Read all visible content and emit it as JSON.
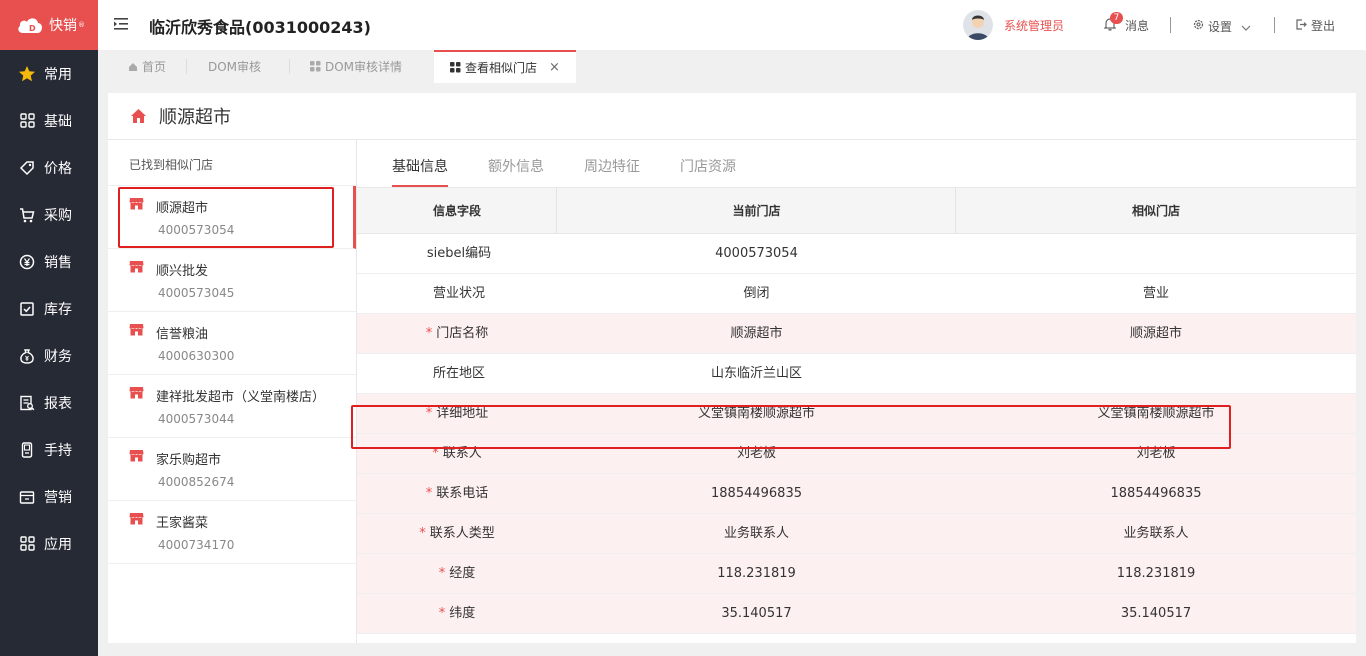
{
  "app": {
    "brand": "快销",
    "brand_mark": "®"
  },
  "sidebar": {
    "items": [
      {
        "label": "常用",
        "icon": "star-icon"
      },
      {
        "label": "基础",
        "icon": "grid-icon"
      },
      {
        "label": "价格",
        "icon": "tag-icon"
      },
      {
        "label": "采购",
        "icon": "cart-icon"
      },
      {
        "label": "销售",
        "icon": "yen-icon"
      },
      {
        "label": "库存",
        "icon": "checkbox-icon"
      },
      {
        "label": "财务",
        "icon": "moneybag-icon"
      },
      {
        "label": "报表",
        "icon": "report-icon"
      },
      {
        "label": "手持",
        "icon": "handheld-icon"
      },
      {
        "label": "营销",
        "icon": "shop-icon"
      },
      {
        "label": "应用",
        "icon": "apps-icon"
      }
    ]
  },
  "header": {
    "title": "临沂欣秀食品(0031000243)",
    "user": "系统管理员",
    "msg_count": "7",
    "msg_label": "消息",
    "settings_label": "设置",
    "logout_label": "登出"
  },
  "tabs": [
    {
      "label": "首页"
    },
    {
      "label": "DOM审核"
    },
    {
      "label": "DOM审核详情"
    },
    {
      "label": "查看相似门店",
      "close": "×"
    }
  ],
  "store": {
    "name": "顺源超市"
  },
  "left": {
    "hint": "已找到相似门店",
    "stores": [
      {
        "name": "顺源超市",
        "code": "4000573054"
      },
      {
        "name": "顺兴批发",
        "code": "4000573045"
      },
      {
        "name": "信誉粮油",
        "code": "4000630300"
      },
      {
        "name": "建祥批发超市（义堂南楼店）",
        "code": "4000573044"
      },
      {
        "name": "家乐购超市",
        "code": "4000852674"
      },
      {
        "name": "王家酱菜",
        "code": "4000734170"
      }
    ]
  },
  "subtabs": [
    {
      "label": "基础信息"
    },
    {
      "label": "额外信息"
    },
    {
      "label": "周边特征"
    },
    {
      "label": "门店资源"
    }
  ],
  "grid": {
    "headers": [
      "信息字段",
      "当前门店",
      "相似门店"
    ],
    "rows": [
      {
        "field": "siebel编码",
        "required": "",
        "current": "4000573054",
        "similar": ""
      },
      {
        "field": "营业状况",
        "required": "",
        "current": "倒闭",
        "similar": "营业"
      },
      {
        "field": "门店名称",
        "required": "*",
        "current": "顺源超市",
        "similar": "顺源超市"
      },
      {
        "field": "所在地区",
        "required": "",
        "current": "山东临沂兰山区",
        "similar": ""
      },
      {
        "field": "详细地址",
        "required": "*",
        "current": "义堂镇南楼顺源超市",
        "similar": "义堂镇南楼顺源超市"
      },
      {
        "field": "联系人",
        "required": "*",
        "current": "刘老板",
        "similar": "刘老板"
      },
      {
        "field": "联系电话",
        "required": "*",
        "current": "18854496835",
        "similar": "18854496835"
      },
      {
        "field": "联系人类型",
        "required": "*",
        "current": "业务联系人",
        "similar": "业务联系人"
      },
      {
        "field": "经度",
        "required": "*",
        "current": "118.231819",
        "similar": "118.231819"
      },
      {
        "field": "纬度",
        "required": "*",
        "current": "35.140517",
        "similar": "35.140517"
      }
    ]
  },
  "colors": {
    "accent": "#e8504f",
    "sidebar_bg": "#262a35",
    "highlight_row": "#fdf0f0",
    "annotation_box": "#e02020"
  }
}
